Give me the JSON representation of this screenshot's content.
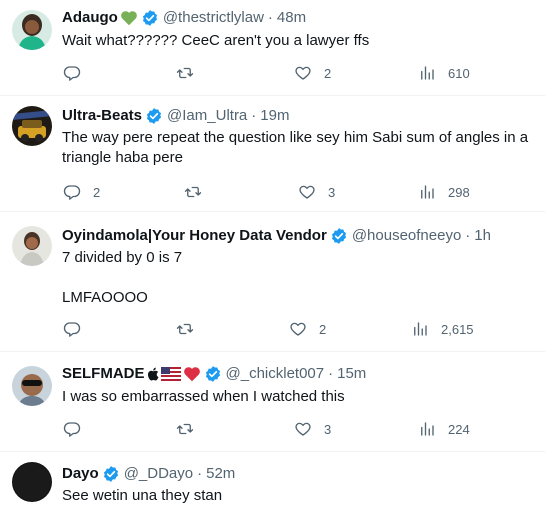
{
  "tweets": [
    {
      "name": "Adaugo",
      "emoji": "green-heart",
      "verified": true,
      "handle": "@thestrictlylaw",
      "time": "48m",
      "text": "Wait what?????? CeeC aren't you a lawyer ffs",
      "replies": "",
      "retweets": "",
      "likes": "2",
      "views": "610"
    },
    {
      "name": "Ultra-Beats",
      "verified": true,
      "handle": "@Iam_Ultra",
      "time": "19m",
      "text": "The way pere repeat the question like sey him Sabi sum of angles in a triangle haba pere",
      "replies": "2",
      "retweets": "",
      "likes": "3",
      "views": "298"
    },
    {
      "name": "Oyindamola|Your Honey Data Vendor",
      "verified": true,
      "handle": "@houseofneeyo",
      "time": "1h",
      "text": "7 divided by 0 is 7",
      "text2": "LMFAOOOO",
      "replies": "",
      "retweets": "",
      "likes": "2",
      "views": "2,615"
    },
    {
      "name": "SELFMADE",
      "emojis": [
        "apple-icon",
        "us-flag",
        "red-heart"
      ],
      "verified": true,
      "handle": "@_chicklet007",
      "time": "15m",
      "text": "I was so embarrassed when I watched this",
      "replies": "",
      "retweets": "",
      "likes": "3",
      "views": "224"
    },
    {
      "name": "Dayo",
      "verified": true,
      "handle": "@_DDayo",
      "time": "52m",
      "text": "See wetin una they stan"
    }
  ],
  "separator": "·",
  "colors": {
    "verified": "#1d9bf0",
    "muted": "#536471",
    "text": "#0f1419",
    "divider": "#eff3f4"
  }
}
